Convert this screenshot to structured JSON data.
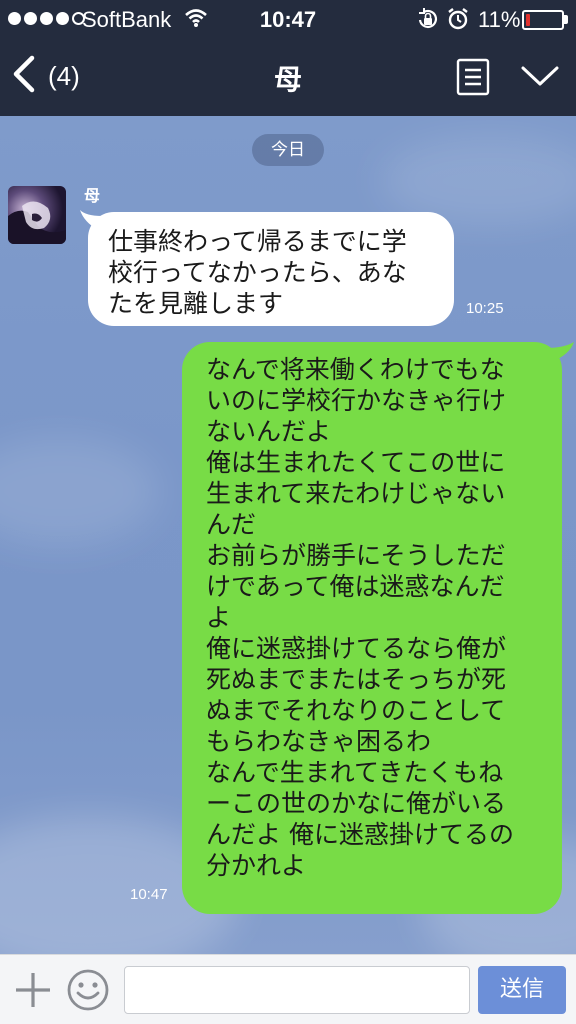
{
  "status_bar": {
    "carrier": "SoftBank",
    "time": "10:47",
    "battery_percent": "11%",
    "battery_level": 0.11,
    "signal_bars": 4,
    "signal_total": 5
  },
  "nav": {
    "back_count": "(4)",
    "title": "母"
  },
  "chat": {
    "date_label": "今日",
    "messages": [
      {
        "direction": "incoming",
        "sender": "母",
        "text": "仕事終わって帰るまでに学\n校行ってなかったら、あな\nたを見離します",
        "time": "10:25"
      },
      {
        "direction": "outgoing",
        "text": "なんで将来働くわけでもな\nいのに学校行かなきゃ行け\nないんだよ\n俺は生まれたくてこの世に\n生まれて来たわけじゃない\nんだ\nお前らが勝手にそうしただ\nけであって俺は迷惑なんだ\nよ\n俺に迷惑掛けてるなら俺が\n死ぬまでまたはそっちが死\nぬまでそれなりのことして\nもらわなきゃ困るわ\nなんで生まれてきたくもね\nーこの世のかなに俺がいる\nんだよ 俺に迷惑掛けてるの\n分かれよ",
        "time": "10:47"
      }
    ]
  },
  "input_bar": {
    "value": "",
    "send_label": "送信"
  },
  "colors": {
    "header_bg": "#242c3e",
    "outgoing_bubble": "#78dc46",
    "incoming_bubble": "#ffffff",
    "chat_bg": "#7b97c9",
    "send_button": "#6c8fd8",
    "battery_low": "#e0302d"
  },
  "icons": {
    "back": "chevron-left-icon",
    "menu": "list-icon",
    "collapse": "chevron-down-icon",
    "plus": "plus-icon",
    "emoji": "smiley-icon",
    "wifi": "wifi-icon",
    "lock": "rotation-lock-icon",
    "alarm": "alarm-icon"
  }
}
